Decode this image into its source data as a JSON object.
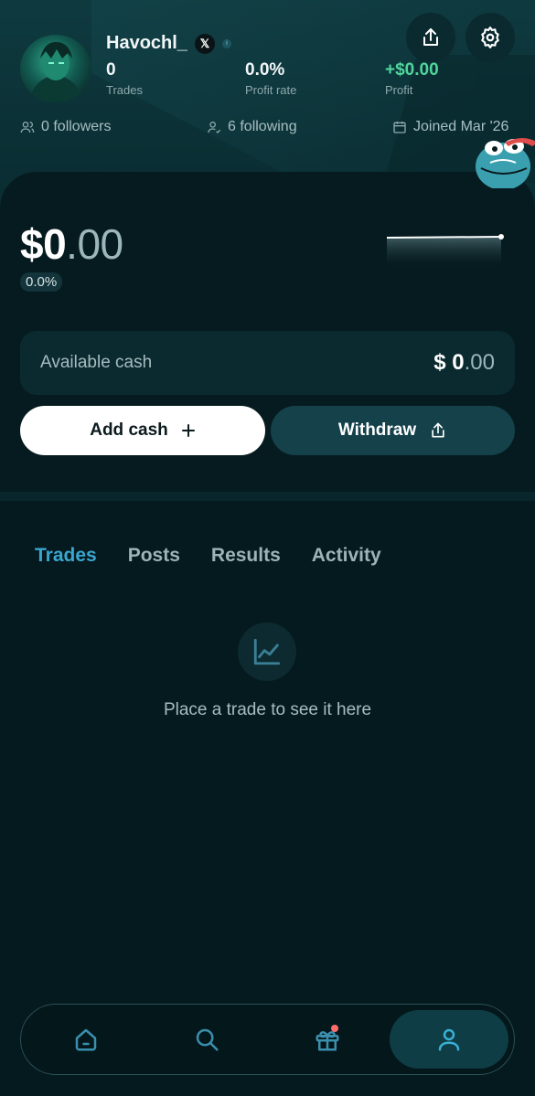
{
  "profile": {
    "username": "Havochl_",
    "x_badge": "𝕏",
    "info_badge": "i",
    "stats": {
      "trades_value": "0",
      "trades_label": "Trades",
      "profit_rate_value": "0.0%",
      "profit_rate_label": "Profit rate",
      "profit_value": "+$0.00",
      "profit_label": "Profit"
    },
    "followers": "0 followers",
    "following": "6 following",
    "joined": "Joined Mar '26"
  },
  "wallet": {
    "balance_main": "$0",
    "balance_cents": ".00",
    "change_pct": "0.0%",
    "available_label": "Available cash",
    "available_main": "$ 0",
    "available_cents": ".00",
    "add_cash_label": "Add cash",
    "withdraw_label": "Withdraw"
  },
  "tabs": [
    {
      "label": "Trades",
      "active": true
    },
    {
      "label": "Posts",
      "active": false
    },
    {
      "label": "Results",
      "active": false
    },
    {
      "label": "Activity",
      "active": false
    }
  ],
  "empty_state": {
    "icon": "line-chart-icon",
    "text": "Place a trade to see it here"
  },
  "nav": [
    {
      "icon": "home-icon",
      "active": false
    },
    {
      "icon": "search-icon",
      "active": false
    },
    {
      "icon": "gift-icon",
      "active": false,
      "notification": true
    },
    {
      "icon": "profile-icon",
      "active": true
    }
  ],
  "colors": {
    "accent": "#3aa6d0",
    "profit_green": "#4fd69c",
    "background": "#051a1e",
    "notification": "#ff6b6b"
  }
}
